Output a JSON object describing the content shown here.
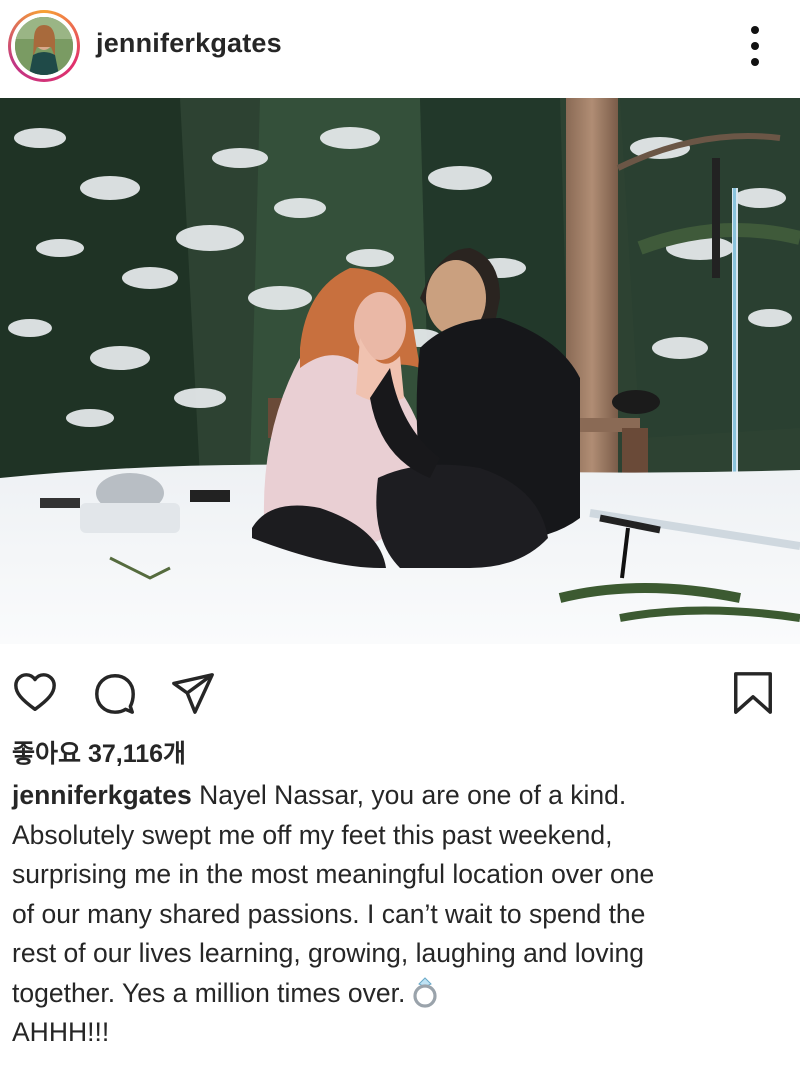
{
  "post": {
    "username": "jenniferkgates",
    "likes_text": "좋아요 37,116개",
    "caption": {
      "username": "jenniferkgates",
      "lines": [
        "Nayel Nassar, you are one of a kind.",
        "Absolutely swept me off my feet this past weekend,",
        "surprising me in the most meaningful location over one",
        "of our many shared passions. I can’t wait to spend the",
        "rest of our lives learning, growing, laughing and loving",
        "together. Yes a million times over.",
        "AHHH!!!"
      ],
      "emoji": "ring-icon"
    }
  },
  "icons": {
    "more": "more-vertical-icon",
    "like": "heart-icon",
    "comment": "comment-icon",
    "share": "send-icon",
    "save": "bookmark-icon"
  },
  "colors": {
    "text": "#262626",
    "story_ring_start": "#f7a234",
    "story_ring_end": "#c13584"
  }
}
